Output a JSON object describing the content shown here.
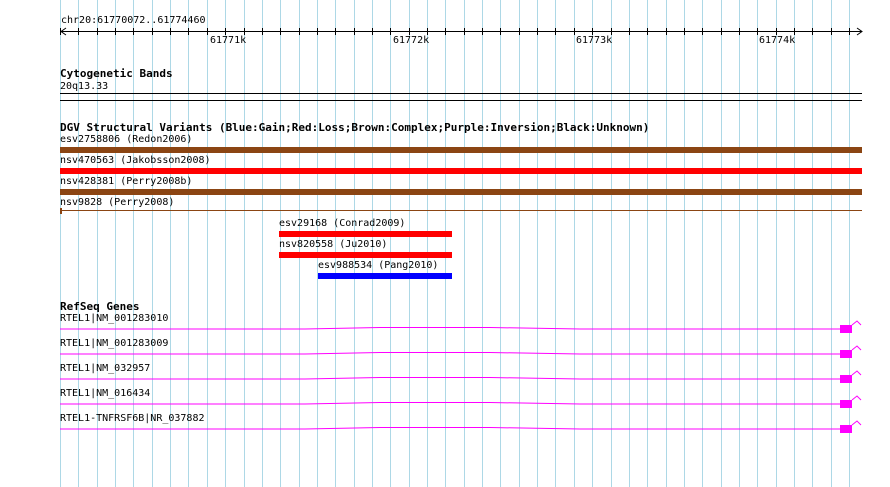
{
  "ruler": {
    "label": "chr20:61770072..61774460",
    "ticks": [
      "61771k",
      "61772k",
      "61773k",
      "61774k"
    ]
  },
  "cytobands": {
    "title": "Cytogenetic Bands",
    "band": "20q13.33"
  },
  "dgv": {
    "title": "DGV Structural Variants (Blue:Gain;Red:Loss;Brown:Complex;Purple:Inversion;Black:Unknown)",
    "variants": [
      {
        "label": "esv2758806 (Redon2006)",
        "color": "#8b4513"
      },
      {
        "label": "nsv470563 (Jakobsson2008)",
        "color": "#ff0000"
      },
      {
        "label": "nsv428381 (Perry2008b)",
        "color": "#8b4513"
      },
      {
        "label": "nsv9828 (Perry2008)",
        "color": "#8b4513"
      },
      {
        "label": "esv29168 (Conrad2009)",
        "color": "#ff0000"
      },
      {
        "label": "nsv820558 (Ju2010)",
        "color": "#ff0000"
      },
      {
        "label": "esv988534 (Pang2010)",
        "color": "#0000ff"
      }
    ]
  },
  "refseq": {
    "title": "RefSeq Genes",
    "genes": [
      {
        "label": "RTEL1|NM_001283010"
      },
      {
        "label": "RTEL1|NM_001283009"
      },
      {
        "label": "RTEL1|NM_032957"
      },
      {
        "label": "RTEL1|NM_016434"
      },
      {
        "label": "RTEL1-TNFRSF6B|NR_037882"
      }
    ],
    "color": "#ff00ff"
  },
  "colors": {
    "grid": "#add8e6",
    "brown": "#8b4513",
    "red": "#ff0000",
    "blue": "#0000ff",
    "magenta": "#ff00ff"
  }
}
